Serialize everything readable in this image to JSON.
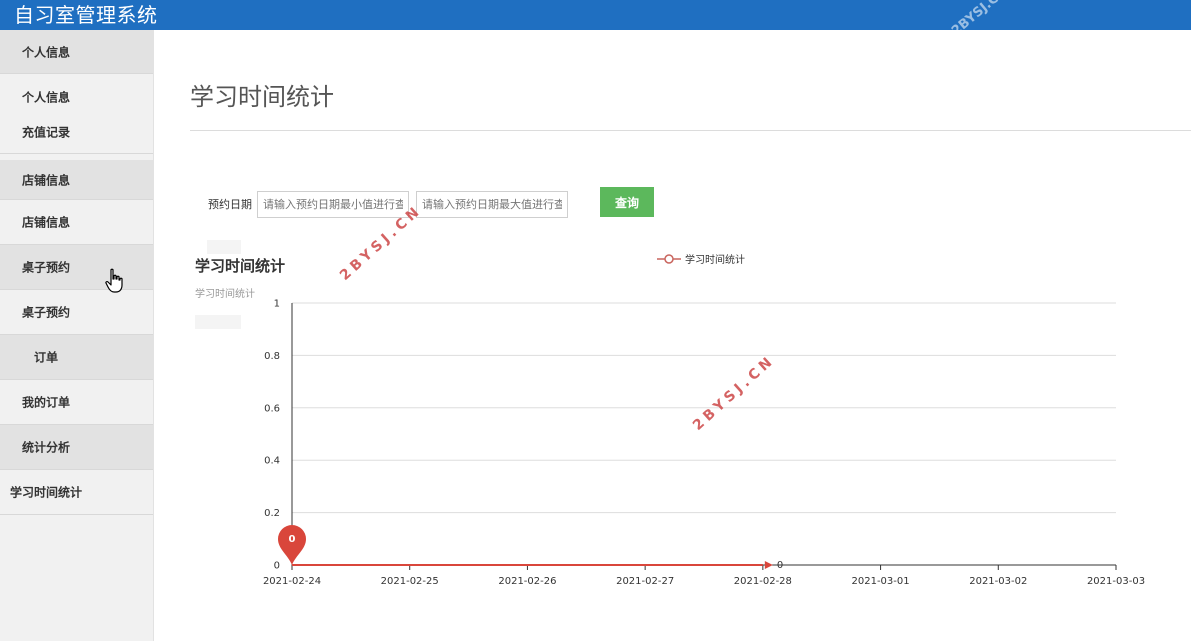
{
  "app": {
    "title": "自习室管理系统"
  },
  "sidebar": {
    "items": [
      {
        "label": "个人信息",
        "kind": "group"
      },
      {
        "label": "个人信息",
        "kind": "item"
      },
      {
        "label": "充值记录",
        "kind": "item"
      },
      {
        "label": "店铺信息",
        "kind": "group"
      },
      {
        "label": "店铺信息",
        "kind": "item"
      },
      {
        "label": "桌子预约",
        "kind": "group"
      },
      {
        "label": "桌子预约",
        "kind": "item"
      },
      {
        "label": "订单",
        "kind": "group"
      },
      {
        "label": "我的订单",
        "kind": "item"
      },
      {
        "label": "统计分析",
        "kind": "group"
      },
      {
        "label": "学习时间统计",
        "kind": "item"
      }
    ]
  },
  "main": {
    "page_title": "学习时间统计",
    "filter": {
      "label": "预约日期",
      "min_placeholder": "请输入预约日期最小值进行查",
      "max_placeholder": "请输入预约日期最大值进行查",
      "query_label": "查询"
    },
    "chart": {
      "title": "学习时间统计",
      "subtitle": "学习时间统计"
    }
  },
  "watermark": "2BYSJ.CN",
  "colors": {
    "topbar": "#1f6fc1",
    "query_button": "#5cb85c",
    "series": "#d9463b"
  },
  "chart_data": {
    "type": "line",
    "title": "学习时间统计",
    "subtitle": "学习时间统计",
    "categories": [
      "2021-02-24",
      "2021-02-25",
      "2021-02-26",
      "2021-02-27",
      "2021-02-28",
      "2021-03-01",
      "2021-03-02",
      "2021-03-03"
    ],
    "y_ticks": [
      "0",
      "0.2",
      "0.4",
      "0.6",
      "0.8",
      "1"
    ],
    "ylim": [
      0,
      1
    ],
    "series": [
      {
        "name": "学习时间统计",
        "values": [
          0,
          0,
          0,
          0,
          0,
          null,
          null,
          null
        ],
        "max_marker": "0",
        "end_label": "0"
      }
    ],
    "legend": "top-center",
    "grid": true
  }
}
